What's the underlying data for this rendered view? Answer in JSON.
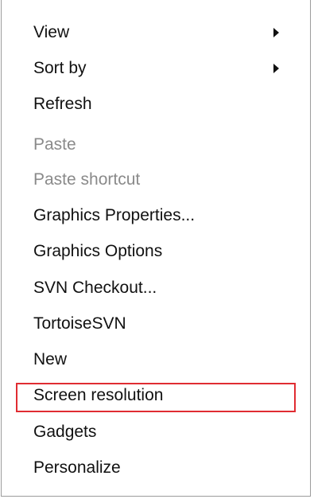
{
  "context_menu": {
    "items": [
      {
        "label": "View",
        "enabled": true,
        "submenu": true
      },
      {
        "label": "Sort by",
        "enabled": true,
        "submenu": true
      },
      {
        "label": "Refresh",
        "enabled": true,
        "submenu": false
      },
      {
        "label": "Paste",
        "enabled": false,
        "submenu": false
      },
      {
        "label": "Paste shortcut",
        "enabled": false,
        "submenu": false
      },
      {
        "label": "Graphics Properties...",
        "enabled": true,
        "submenu": false
      },
      {
        "label": "Graphics Options",
        "enabled": true,
        "submenu": false
      },
      {
        "label": "SVN Checkout...",
        "enabled": true,
        "submenu": false
      },
      {
        "label": "TortoiseSVN",
        "enabled": true,
        "submenu": false
      },
      {
        "label": "New",
        "enabled": true,
        "submenu": false
      },
      {
        "label": "Screen resolution",
        "enabled": true,
        "submenu": false,
        "highlighted": true
      },
      {
        "label": "Gadgets",
        "enabled": true,
        "submenu": false
      },
      {
        "label": "Personalize",
        "enabled": true,
        "submenu": false
      }
    ]
  },
  "colors": {
    "text": "#111111",
    "disabled_text": "#8a8a8a",
    "highlight_border": "#e02c32",
    "menu_border": "#9c9c9c"
  }
}
